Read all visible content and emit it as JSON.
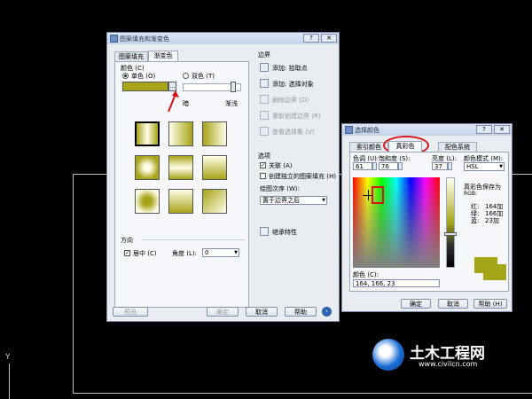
{
  "axis_label": "Y",
  "main_dialog": {
    "title": "图案填充和渐变色",
    "tabs": [
      "图案填充",
      "渐变色"
    ],
    "color_section": {
      "label": "颜色 (C)",
      "single_label": "单色 (O)",
      "double_label": "双色 (T)",
      "shade_label": "暗",
      "tint_label": "渐浅",
      "color": "#a8a318"
    },
    "boundary": {
      "label": "边界",
      "items": [
        "添加: 拾取点",
        "添加: 选择对象",
        "删除边界 (D)",
        "重新创建边界 (R)",
        "查看选择集 (V)"
      ]
    },
    "options": {
      "label": "选项",
      "associative": "关联 (A)",
      "separate": "创建独立的图案填充 (H)",
      "draw_order_label": "绘图次序 (W):",
      "draw_order_value": "置于边界之后"
    },
    "inherit": "继承特性",
    "orientation": {
      "label": "方向",
      "centered": "居中 (C)",
      "angle_label": "角度 (L):",
      "angle_value": "0"
    },
    "buttons": {
      "preview": "预览",
      "ok": "确定",
      "cancel": "取消",
      "help": "帮助"
    }
  },
  "color_dialog": {
    "title": "选择颜色",
    "tabs": [
      "索引颜色",
      "真彩色",
      "配色系统"
    ],
    "hue_label": "色调 (U):",
    "hue_value": "61",
    "sat_label": "饱和度 (S):",
    "sat_value": "76",
    "lum_label": "亮度 (L):",
    "lum_value": "37",
    "model_label": "颜色模式 (M):",
    "model_value": "HSL",
    "save_label": "真彩色保存为",
    "rgb_label": "RGB:",
    "red_label": "红:",
    "red_value": "164加",
    "green_label": "绿:",
    "green_value": "166加",
    "blue_label": "蓝:",
    "blue_value": "23加",
    "color_label": "颜色 (C):",
    "color_value": "164, 166, 23",
    "buttons": {
      "ok": "确定",
      "cancel": "取消",
      "help": "帮助 (H)"
    },
    "swatch": "#a4a617"
  },
  "watermark": {
    "name": "土木工程网",
    "url": "www.civilcn.com"
  }
}
